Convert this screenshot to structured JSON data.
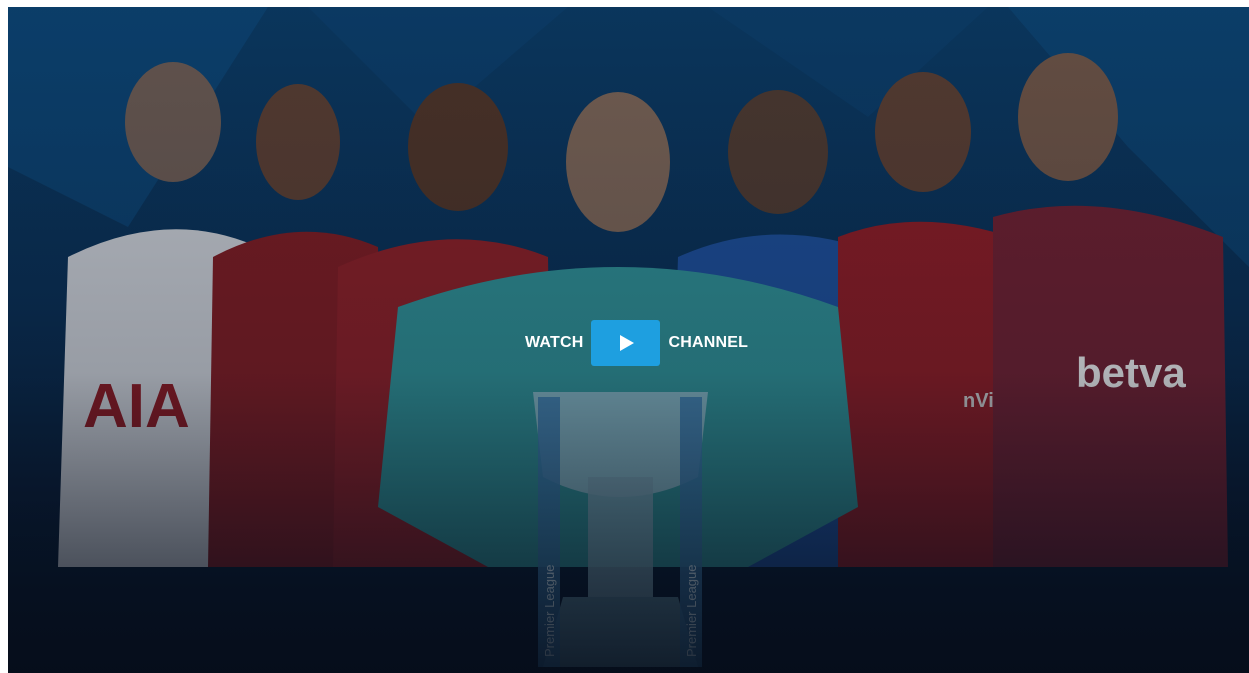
{
  "hero": {
    "cta_prefix": "WATCH",
    "cta_suffix": "CHANNEL",
    "play_button_icon": "play-icon",
    "jersey_texts": {
      "sponsor_left": "AIA",
      "sponsor_right": "betva",
      "sponsor_center_right": "nView"
    },
    "trophy_text": "Premier League"
  },
  "colors": {
    "play_button": "#1e9fe0",
    "background_top": "#0b3a63",
    "background_bottom": "#081526"
  }
}
